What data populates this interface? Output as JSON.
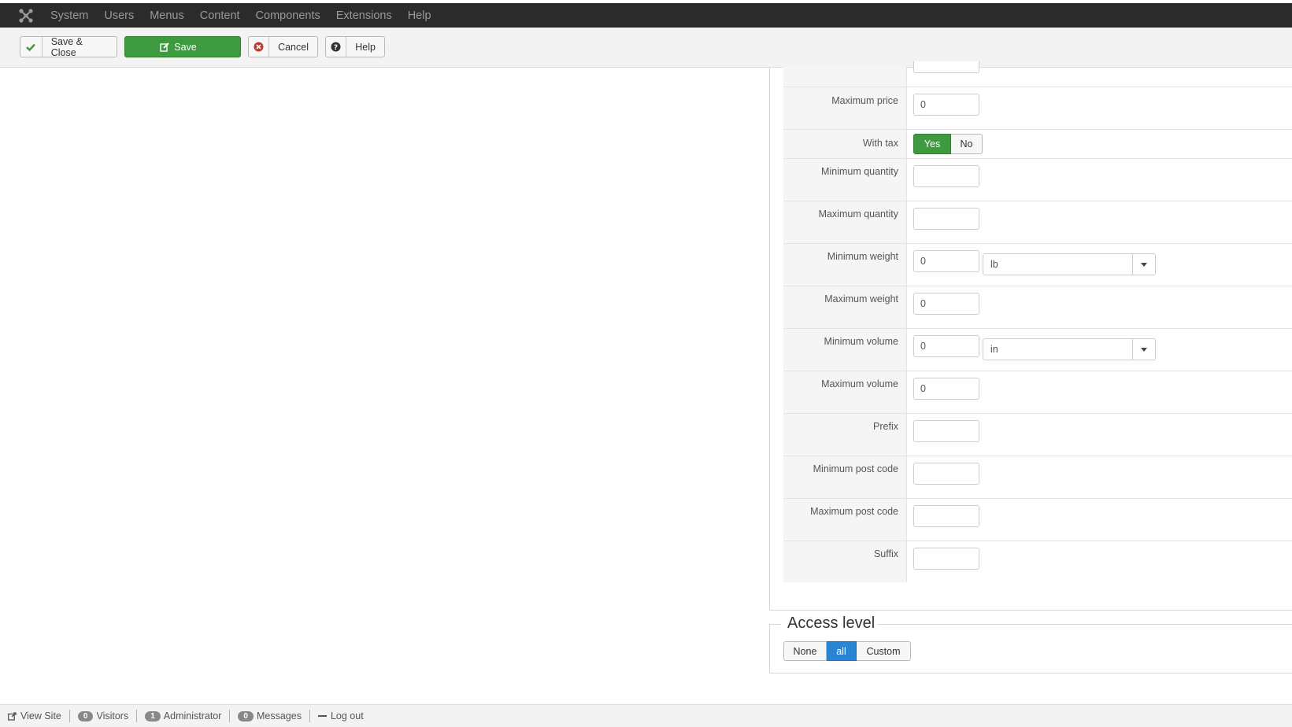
{
  "topbar": {
    "menu": [
      "System",
      "Users",
      "Menus",
      "Content",
      "Components",
      "Extensions",
      "Help"
    ]
  },
  "toolbar": {
    "save_close_label": "Save & Close",
    "save_label": "Save",
    "cancel_label": "Cancel",
    "help_label": "Help"
  },
  "form": {
    "maximum_price": {
      "label": "Maximum price",
      "value": "0"
    },
    "with_tax": {
      "label": "With tax",
      "yes": "Yes",
      "no": "No",
      "selected": "Yes"
    },
    "minimum_quantity": {
      "label": "Minimum quantity",
      "value": ""
    },
    "maximum_quantity": {
      "label": "Maximum quantity",
      "value": ""
    },
    "minimum_weight": {
      "label": "Minimum weight",
      "value": "0",
      "unit": "lb"
    },
    "maximum_weight": {
      "label": "Maximum weight",
      "value": "0"
    },
    "minimum_volume": {
      "label": "Minimum volume",
      "value": "0",
      "unit": "in"
    },
    "maximum_volume": {
      "label": "Maximum volume",
      "value": "0"
    },
    "prefix": {
      "label": "Prefix",
      "value": ""
    },
    "minimum_post_code": {
      "label": "Minimum post code",
      "value": ""
    },
    "maximum_post_code": {
      "label": "Maximum post code",
      "value": ""
    },
    "suffix": {
      "label": "Suffix",
      "value": ""
    }
  },
  "access": {
    "title": "Access level",
    "options": [
      "None",
      "all",
      "Custom"
    ],
    "selected": "all"
  },
  "statusbar": {
    "view_site": "View Site",
    "visitors_count": "0",
    "visitors_label": "Visitors",
    "admin_count": "1",
    "admin_label": "Administrator",
    "messages_count": "0",
    "messages_label": "Messages",
    "logout": "Log out"
  },
  "colors": {
    "topbar_bg": "#2b2b2b",
    "success_green": "#3e9a3e",
    "active_blue": "#2a84d4",
    "cancel_red": "#c0392b"
  }
}
